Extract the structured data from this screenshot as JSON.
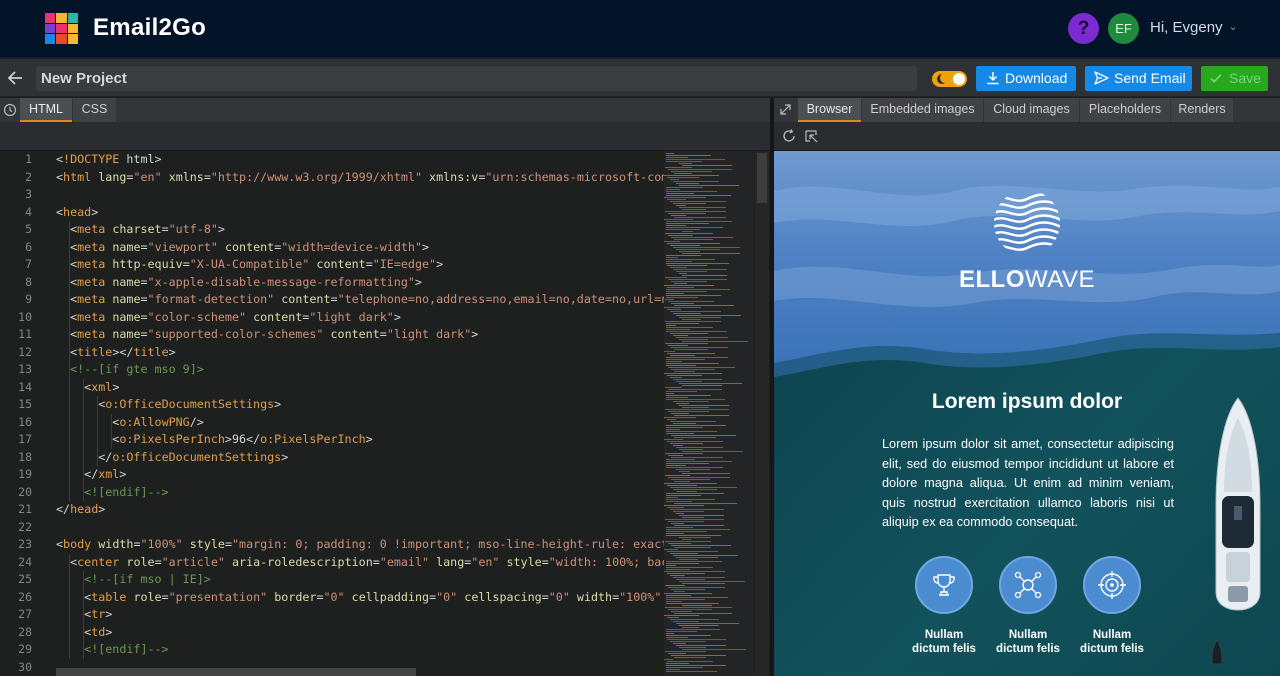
{
  "app": {
    "brand": "Email2Go",
    "help_icon_text": "?",
    "user_initials": "EF",
    "user_greeting": "Hi, Evgeny",
    "logo_colors": [
      "#e8336b",
      "#f7b731",
      "#2bb6a8",
      "#7b3fd0",
      "#e8336b",
      "#f7b731",
      "#1688e6",
      "#e84a2a",
      "#f7b731"
    ]
  },
  "project": {
    "name": "New Project",
    "download_label": "Download",
    "send_label": "Send Email",
    "save_label": "Save"
  },
  "editor": {
    "tabs": [
      "HTML",
      "CSS"
    ],
    "active_tab": "HTML",
    "line_numbers": [
      "1",
      "2",
      "3",
      "4",
      "5",
      "6",
      "7",
      "8",
      "9",
      "10",
      "11",
      "12",
      "13",
      "14",
      "15",
      "16",
      "17",
      "18",
      "19",
      "20",
      "21",
      "22",
      "23",
      "24",
      "25",
      "26",
      "27",
      "28",
      "29",
      "30"
    ],
    "lines": [
      "<!DOCTYPE html>",
      "<html lang=\"en\" xmlns=\"http://www.w3.org/1999/xhtml\" xmlns:v=\"urn:schemas-microsoft-com",
      "",
      "<head>",
      "  <meta charset=\"utf-8\">",
      "  <meta name=\"viewport\" content=\"width=device-width\">",
      "  <meta http-equiv=\"X-UA-Compatible\" content=\"IE=edge\">",
      "  <meta name=\"x-apple-disable-message-reformatting\">",
      "  <meta name=\"format-detection\" content=\"telephone=no,address=no,email=no,date=no,url=n",
      "  <meta name=\"color-scheme\" content=\"light dark\">",
      "  <meta name=\"supported-color-schemes\" content=\"light dark\">",
      "  <title></title>",
      "  <!--[if gte mso 9]>",
      "    <xml>",
      "      <o:OfficeDocumentSettings>",
      "        <o:AllowPNG/>",
      "        <o:PixelsPerInch>96</o:PixelsPerInch>",
      "      </o:OfficeDocumentSettings>",
      "    </xml>",
      "    <![endif]-->",
      "</head>",
      "",
      "<body width=\"100%\" style=\"margin: 0; padding: 0 !important; mso-line-height-rule: exact",
      "  <center role=\"article\" aria-roledescription=\"email\" lang=\"en\" style=\"width: 100%; bac",
      "    <!--[if mso | IE]>",
      "    <table role=\"presentation\" border=\"0\" cellpadding=\"0\" cellspacing=\"0\" width=\"100%\"",
      "    <tr>",
      "    <td>",
      "    <![endif]-->",
      ""
    ]
  },
  "preview": {
    "tabs": [
      "Browser",
      "Embedded images",
      "Cloud images",
      "Placeholders",
      "Renders"
    ],
    "active_tab": "Browser",
    "email": {
      "brand_bold": "ELLO",
      "brand_light": "WAVE",
      "title": "Lorem ipsum dolor",
      "body": "Lorem ipsum dolor sit amet, consectetur adipiscing elit, sed do eiusmod tempor incididunt ut labore et dolore magna aliqua. Ut enim ad minim veniam, quis nostrud exercitation ullamco laboris nisi ut aliquip ex ea commodo consequat.",
      "features": [
        {
          "icon": "trophy-icon",
          "line1": "Nullam",
          "line2": "dictum felis"
        },
        {
          "icon": "network-icon",
          "line1": "Nullam",
          "line2": "dictum felis"
        },
        {
          "icon": "target-icon",
          "line1": "Nullam",
          "line2": "dictum felis"
        }
      ]
    }
  },
  "colors": {
    "topbar": "#041428",
    "accent_blue": "#1688e6",
    "save_green": "#28a81f",
    "tab_underline": "#e0861f",
    "help_purple": "#7b2bd1",
    "avatar_green": "#1f8a3b"
  }
}
